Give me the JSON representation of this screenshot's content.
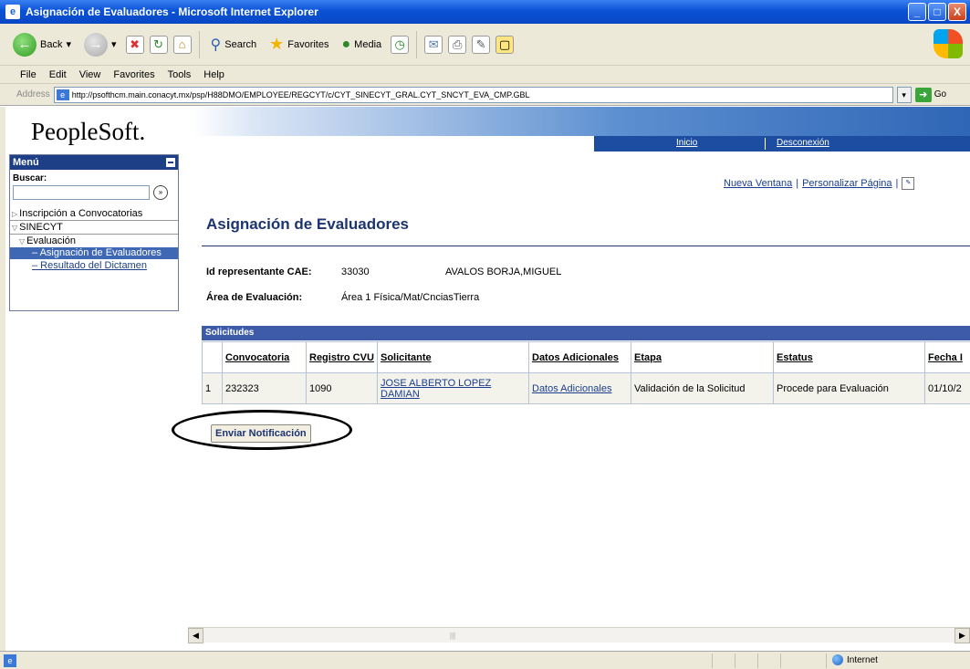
{
  "window": {
    "title": "Asignación de Evaluadores - Microsoft Internet Explorer",
    "app_icon": "e",
    "buttons": [
      "_",
      "□",
      "X"
    ]
  },
  "toolbar": {
    "back_label": "Back",
    "search_label": "Search",
    "favorites_label": "Favorites",
    "media_label": "Media"
  },
  "menubar": [
    "File",
    "Edit",
    "View",
    "Favorites",
    "Tools",
    "Help"
  ],
  "address": {
    "label": "Address",
    "url": "http://psofthcm.main.conacyt.mx/psp/H88DMO/EMPLOYEE/REGCYT/c/CYT_SINECYT_GRAL.CYT_SNCYT_EVA_CMP.GBL",
    "go_label": "Go"
  },
  "brand": {
    "logo_text": "PeopleSoft."
  },
  "nav": {
    "home": "Inicio",
    "logout": "Desconexión"
  },
  "menu": {
    "title": "Menú",
    "search_label": "Buscar:",
    "search_value": "",
    "search_go": "»",
    "items": [
      {
        "label": "Inscripción a Convocatorias"
      },
      {
        "label": "SINECYT"
      },
      {
        "label": "Evaluación"
      },
      {
        "label": "– Asignación de Evaluadores"
      },
      {
        "label": "– Resultado del Dictamen"
      }
    ]
  },
  "top_links": {
    "new_window": "Nueva Ventana",
    "personalize": "Personalizar Página",
    "sep": "|"
  },
  "page": {
    "title": "Asignación de Evaluadores",
    "cae_label": "Id representante CAE:",
    "cae_value": "33030",
    "cae_name": "AVALOS BORJA,MIGUEL",
    "area_label": "Área de Evaluación:",
    "area_value": "Área 1 Física/Mat/CnciasTierra"
  },
  "grid": {
    "title": "Solicitudes",
    "columns": [
      "Convocatoria",
      "Registro CVU",
      "Solicitante",
      "Datos Adicionales",
      "Etapa",
      "Estatus",
      "Fecha I"
    ],
    "rows": [
      {
        "num": "1",
        "convocatoria": "232323",
        "registro_cvu": "1090",
        "solicitante": "JOSE ALBERTO LOPEZ DAMIAN",
        "datos_adicionales": "Datos Adicionales",
        "etapa": "Validación de la Solicitud",
        "estatus": "Procede para Evaluación",
        "fecha": "01/10/2"
      }
    ]
  },
  "actions": {
    "send_notification": "Enviar Notificación"
  },
  "status": {
    "zone": "Internet"
  },
  "colors": {
    "title_blue": "#1c3470",
    "menu_header": "#1c3f86",
    "grid_header": "#3e5ba9"
  }
}
